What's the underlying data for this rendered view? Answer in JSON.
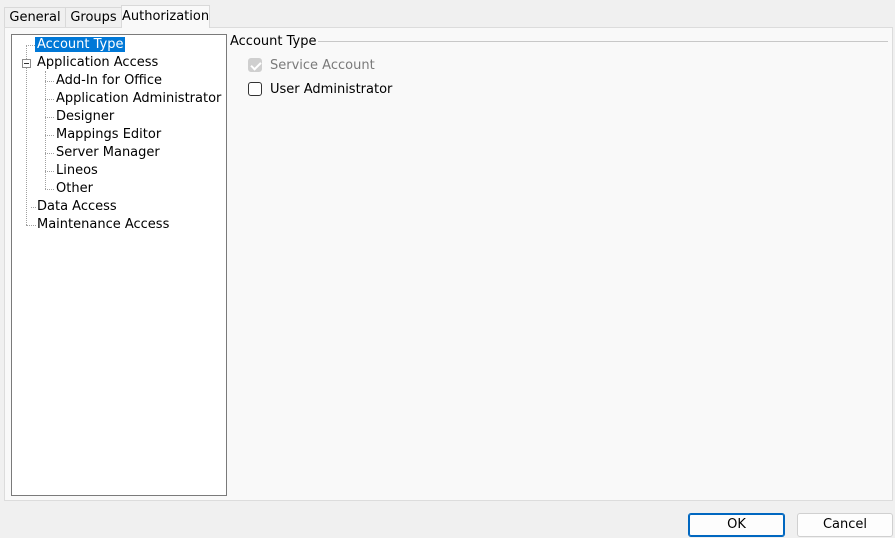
{
  "tabs": [
    {
      "label": "General"
    },
    {
      "label": "Groups"
    },
    {
      "label": "Authorization",
      "active": true
    }
  ],
  "tree": {
    "items": [
      {
        "label": "Account Type",
        "selected": true
      },
      {
        "label": "Application Access",
        "expanded": true
      },
      {
        "label": "Add-In for Office"
      },
      {
        "label": "Application Administrator"
      },
      {
        "label": "Designer"
      },
      {
        "label": "Mappings Editor"
      },
      {
        "label": "Server Manager"
      },
      {
        "label": "Lineos"
      },
      {
        "label": "Other"
      },
      {
        "label": "Data Access"
      },
      {
        "label": "Maintenance Access"
      }
    ]
  },
  "account_type": {
    "title": "Account Type",
    "options": [
      {
        "label": "Service Account",
        "checked": true,
        "disabled": true
      },
      {
        "label": "User Administrator",
        "checked": false,
        "disabled": false
      }
    ]
  },
  "buttons": {
    "ok": "OK",
    "cancel": "Cancel"
  },
  "colors": {
    "selection": "#0078d7",
    "ok_border": "#0067c0"
  }
}
